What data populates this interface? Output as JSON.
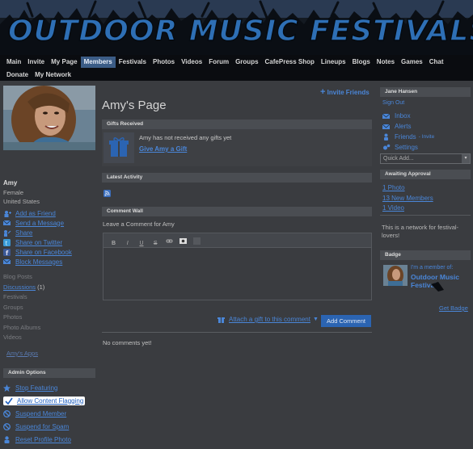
{
  "site": {
    "logo_text": "OUTDOOR MUSIC FESTIVALS"
  },
  "nav": {
    "row1": [
      "Main",
      "Invite",
      "My Page",
      "Members",
      "Festivals",
      "Photos",
      "Videos",
      "Forum",
      "Groups",
      "CafePress Shop",
      "Lineups",
      "Blogs",
      "Notes",
      "Games",
      "Chat"
    ],
    "row2": [
      "Donate",
      "My Network"
    ],
    "active": "Members"
  },
  "profile": {
    "name": "Amy",
    "gender": "Female",
    "location": "United States",
    "actions": [
      "Add as Friend",
      "Send a Message",
      "Share",
      "Share on Twitter",
      "Share on Facebook",
      "Block Messages"
    ],
    "sections": {
      "blog_posts": "Blog Posts",
      "discussions": "Discussions",
      "discussions_count": "(1)",
      "festivals": "Festivals",
      "groups": "Groups",
      "photos": "Photos",
      "photo_albums": "Photo Albums",
      "videos": "Videos",
      "apps": "Amy's Apps"
    }
  },
  "admin": {
    "title": "Admin Options",
    "items": [
      "Stop Featuring",
      "Allow Content Flagging",
      "Suspend Member",
      "Suspend for Spam",
      "Reset Profile Photo"
    ]
  },
  "main": {
    "invite_friends": "Invite Friends",
    "page_title": "Amy's Page",
    "gifts": {
      "title": "Gifts Received",
      "message": "Amy has not received any gifts yet",
      "give_link": "Give Amy a Gift"
    },
    "latest_activity": {
      "title": "Latest Activity"
    },
    "comment_wall": {
      "title": "Comment Wall",
      "prompt": "Leave a Comment for Amy",
      "toolbar": [
        "B",
        "I",
        "U",
        "S",
        "link",
        "media",
        "html"
      ],
      "attach_link": "Attach a gift to this comment",
      "add_button": "Add Comment",
      "empty": "No comments yet!"
    }
  },
  "sidebar": {
    "user": "Jane Hansen",
    "sign_out": "Sign Out",
    "inbox": "Inbox",
    "alerts": "Alerts",
    "friends": "Friends",
    "friends_invite": "- Invite",
    "settings": "Settings",
    "quick_add": "Quick Add...",
    "awaiting_title": "Awaiting Approval",
    "awaiting": [
      "1 Photo",
      "13 New Members",
      "1 Video"
    ],
    "network_text": "This is a network for festival-lovers!",
    "badge_title": "Badge",
    "badge_member": "I'm a member of:",
    "badge_network": "Outdoor Music Festivals",
    "get_badge": "Get Badge"
  },
  "colors": {
    "accent": "#2b64b2",
    "link": "#4a86d8",
    "background": "#3a3c40",
    "nav_bg": "#0a0c10"
  }
}
